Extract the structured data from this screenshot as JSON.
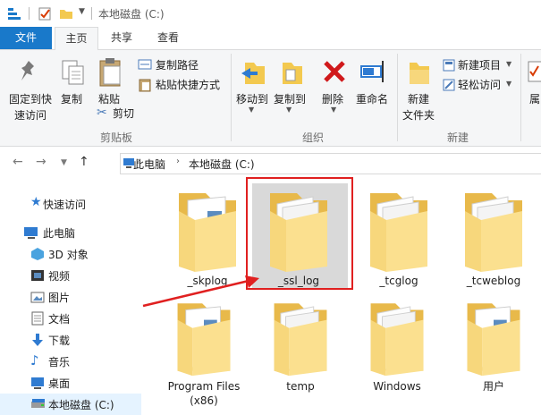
{
  "window": {
    "title": "本地磁盘 (C:)"
  },
  "tabs": {
    "file": "文件",
    "home": "主页",
    "share": "共享",
    "view": "查看"
  },
  "ribbon": {
    "clipboard": {
      "pin_label_1": "固定到快",
      "pin_label_2": "速访问",
      "copy": "复制",
      "paste": "粘贴",
      "copy_path": "复制路径",
      "paste_shortcut": "粘贴快捷方式",
      "cut": "剪切",
      "group": "剪贴板"
    },
    "organize": {
      "move_to": "移动到",
      "copy_to": "复制到",
      "delete": "删除",
      "rename": "重命名",
      "group": "组织"
    },
    "new": {
      "new_folder_1": "新建",
      "new_folder_2": "文件夹",
      "new_item": "新建项目",
      "easy_access": "轻松访问",
      "group": "新建"
    },
    "open": {
      "properties": "属"
    }
  },
  "address": {
    "crumb1": "此电脑",
    "crumb2": "本地磁盘 (C:)"
  },
  "nav": {
    "quick_access": "快速访问",
    "this_pc": "此电脑",
    "objects3d": "3D 对象",
    "videos": "视频",
    "pictures": "图片",
    "documents": "文档",
    "downloads": "下载",
    "music": "音乐",
    "desktop": "桌面",
    "local_disk": "本地磁盘 (C:)"
  },
  "folders": {
    "skplog": "_skplog",
    "ssl_log": "_ssl_log",
    "tcglog": "_tcglog",
    "tcweblog": "_tcweblog",
    "program_files_1": "Program Files",
    "program_files_2": "(x86)",
    "temp": "temp",
    "windows": "Windows",
    "users": "用户"
  },
  "colors": {
    "accent": "#1979ca",
    "highlight_border": "#e02020",
    "folder": "#f6d47a"
  }
}
